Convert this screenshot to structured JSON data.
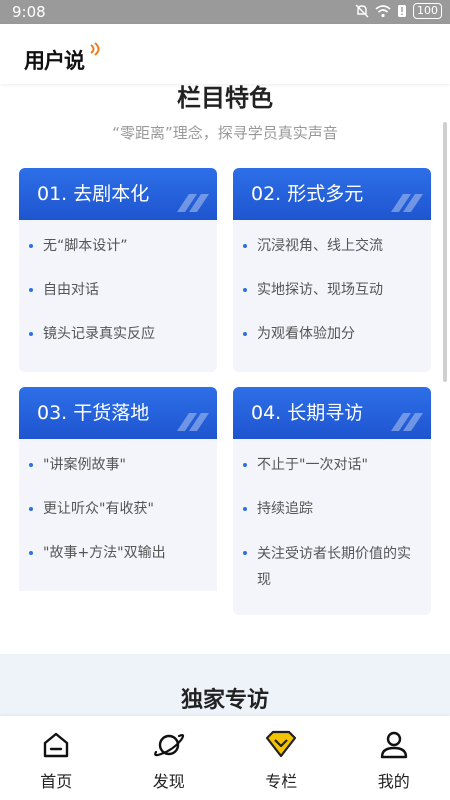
{
  "status": {
    "time": "9:08",
    "battery": "100"
  },
  "app": {
    "logo": "用户说"
  },
  "section": {
    "title": "栏目特色",
    "subtitle": "“零距离”理念，探寻学员真实声音"
  },
  "cards": [
    {
      "title": "01. 去剧本化",
      "items": [
        "无“脚本设计”",
        "自由对话",
        "镜头记录真实反应"
      ]
    },
    {
      "title": "02. 形式多元",
      "items": [
        "沉浸视角、线上交流",
        "实地探访、现场互动",
        "为观看体验加分"
      ]
    },
    {
      "title": "03. 干货落地",
      "items": [
        "\"讲案例故事\"",
        "更让听众\"有收获\"",
        "\"故事+方法\"双输出"
      ]
    },
    {
      "title": "04. 长期寻访",
      "items": [
        "不止于\"一次对话\"",
        "持续追踪",
        "关注受访者长期价值的实现"
      ]
    }
  ],
  "exclusive": {
    "title": "独家专访"
  },
  "tabs": [
    {
      "label": "首页",
      "icon": "home-icon"
    },
    {
      "label": "发现",
      "icon": "planet-icon"
    },
    {
      "label": "专栏",
      "icon": "diamond-icon"
    },
    {
      "label": "我的",
      "icon": "user-icon"
    }
  ],
  "colors": {
    "accent": "#2d6fe8",
    "tab_diamond": "#f5c400"
  }
}
